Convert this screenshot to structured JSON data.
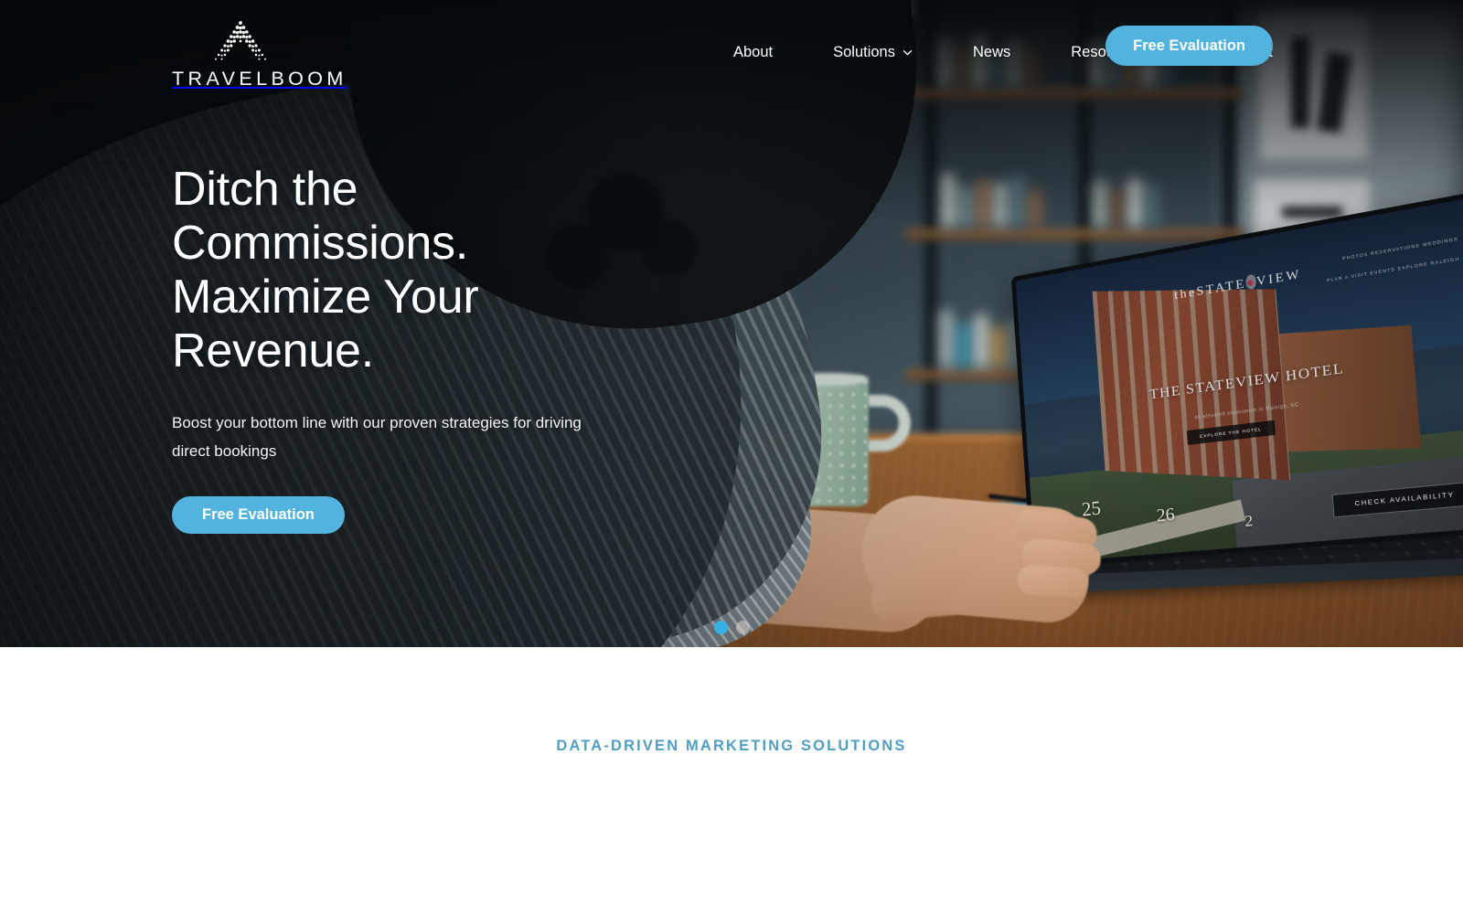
{
  "brand": {
    "name": "TRAVELBOOM",
    "logo_icon": "dotted-chevron-logo-icon",
    "accent_color": "#52b3de",
    "eyebrow_color": "#509ec4"
  },
  "header": {
    "nav_items": [
      {
        "label": "About",
        "has_dropdown": false,
        "icon": ""
      },
      {
        "label": "Solutions",
        "has_dropdown": true,
        "icon": "chevron-down-icon"
      },
      {
        "label": "News",
        "has_dropdown": false,
        "icon": ""
      },
      {
        "label": "Resources",
        "has_dropdown": true,
        "icon": "chevron-down-icon"
      },
      {
        "label": "Contact",
        "has_dropdown": false,
        "icon": ""
      }
    ],
    "cta_label": "Free Evaluation"
  },
  "hero": {
    "title_line1": "Ditch the",
    "title_line2": "Commissions.",
    "title_line3": "Maximize Your",
    "title_line4": "Revenue.",
    "subtitle": "Boost your bottom line with our proven strategies for driving direct bookings",
    "cta_label": "Free Evaluation",
    "carousel": {
      "total_slides": 2,
      "active_slide": 1
    }
  },
  "laptop_screen": {
    "site_logo_pre": "the",
    "site_logo_main": "STATE",
    "site_logo_dot": "●",
    "site_logo_main2": "VIEW",
    "headline": "THE STATEVIEW HOTEL",
    "subheadline": "an elevated experience in Raleigh, NC",
    "nav_row1": "PHOTOS     RESERVATIONS     WEDDINGS",
    "nav_row2": "PLAN A VISIT     EVENTS     EXPLORE RALEIGH",
    "cta_label": "CHECK AVAILABILITY",
    "secondary_btn": "EXPLORE THE HOTEL",
    "marker1": "25",
    "marker2": "26",
    "marker3": "2"
  },
  "section": {
    "eyebrow": "DATA-DRIVEN MARKETING SOLUTIONS"
  }
}
